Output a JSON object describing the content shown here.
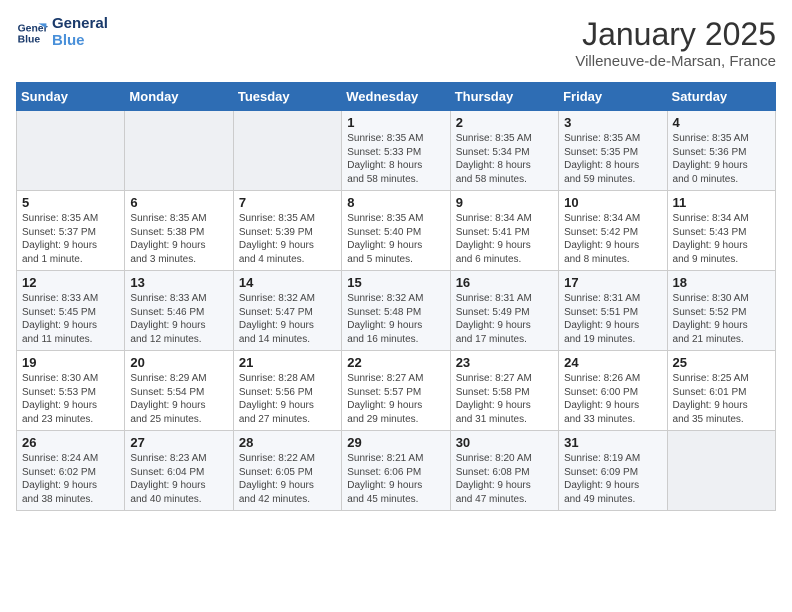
{
  "logo": {
    "line1": "General",
    "line2": "Blue"
  },
  "title": "January 2025",
  "subtitle": "Villeneuve-de-Marsan, France",
  "days_of_week": [
    "Sunday",
    "Monday",
    "Tuesday",
    "Wednesday",
    "Thursday",
    "Friday",
    "Saturday"
  ],
  "weeks": [
    [
      {
        "day": "",
        "info": ""
      },
      {
        "day": "",
        "info": ""
      },
      {
        "day": "",
        "info": ""
      },
      {
        "day": "1",
        "info": "Sunrise: 8:35 AM\nSunset: 5:33 PM\nDaylight: 8 hours\nand 58 minutes."
      },
      {
        "day": "2",
        "info": "Sunrise: 8:35 AM\nSunset: 5:34 PM\nDaylight: 8 hours\nand 58 minutes."
      },
      {
        "day": "3",
        "info": "Sunrise: 8:35 AM\nSunset: 5:35 PM\nDaylight: 8 hours\nand 59 minutes."
      },
      {
        "day": "4",
        "info": "Sunrise: 8:35 AM\nSunset: 5:36 PM\nDaylight: 9 hours\nand 0 minutes."
      }
    ],
    [
      {
        "day": "5",
        "info": "Sunrise: 8:35 AM\nSunset: 5:37 PM\nDaylight: 9 hours\nand 1 minute."
      },
      {
        "day": "6",
        "info": "Sunrise: 8:35 AM\nSunset: 5:38 PM\nDaylight: 9 hours\nand 3 minutes."
      },
      {
        "day": "7",
        "info": "Sunrise: 8:35 AM\nSunset: 5:39 PM\nDaylight: 9 hours\nand 4 minutes."
      },
      {
        "day": "8",
        "info": "Sunrise: 8:35 AM\nSunset: 5:40 PM\nDaylight: 9 hours\nand 5 minutes."
      },
      {
        "day": "9",
        "info": "Sunrise: 8:34 AM\nSunset: 5:41 PM\nDaylight: 9 hours\nand 6 minutes."
      },
      {
        "day": "10",
        "info": "Sunrise: 8:34 AM\nSunset: 5:42 PM\nDaylight: 9 hours\nand 8 minutes."
      },
      {
        "day": "11",
        "info": "Sunrise: 8:34 AM\nSunset: 5:43 PM\nDaylight: 9 hours\nand 9 minutes."
      }
    ],
    [
      {
        "day": "12",
        "info": "Sunrise: 8:33 AM\nSunset: 5:45 PM\nDaylight: 9 hours\nand 11 minutes."
      },
      {
        "day": "13",
        "info": "Sunrise: 8:33 AM\nSunset: 5:46 PM\nDaylight: 9 hours\nand 12 minutes."
      },
      {
        "day": "14",
        "info": "Sunrise: 8:32 AM\nSunset: 5:47 PM\nDaylight: 9 hours\nand 14 minutes."
      },
      {
        "day": "15",
        "info": "Sunrise: 8:32 AM\nSunset: 5:48 PM\nDaylight: 9 hours\nand 16 minutes."
      },
      {
        "day": "16",
        "info": "Sunrise: 8:31 AM\nSunset: 5:49 PM\nDaylight: 9 hours\nand 17 minutes."
      },
      {
        "day": "17",
        "info": "Sunrise: 8:31 AM\nSunset: 5:51 PM\nDaylight: 9 hours\nand 19 minutes."
      },
      {
        "day": "18",
        "info": "Sunrise: 8:30 AM\nSunset: 5:52 PM\nDaylight: 9 hours\nand 21 minutes."
      }
    ],
    [
      {
        "day": "19",
        "info": "Sunrise: 8:30 AM\nSunset: 5:53 PM\nDaylight: 9 hours\nand 23 minutes."
      },
      {
        "day": "20",
        "info": "Sunrise: 8:29 AM\nSunset: 5:54 PM\nDaylight: 9 hours\nand 25 minutes."
      },
      {
        "day": "21",
        "info": "Sunrise: 8:28 AM\nSunset: 5:56 PM\nDaylight: 9 hours\nand 27 minutes."
      },
      {
        "day": "22",
        "info": "Sunrise: 8:27 AM\nSunset: 5:57 PM\nDaylight: 9 hours\nand 29 minutes."
      },
      {
        "day": "23",
        "info": "Sunrise: 8:27 AM\nSunset: 5:58 PM\nDaylight: 9 hours\nand 31 minutes."
      },
      {
        "day": "24",
        "info": "Sunrise: 8:26 AM\nSunset: 6:00 PM\nDaylight: 9 hours\nand 33 minutes."
      },
      {
        "day": "25",
        "info": "Sunrise: 8:25 AM\nSunset: 6:01 PM\nDaylight: 9 hours\nand 35 minutes."
      }
    ],
    [
      {
        "day": "26",
        "info": "Sunrise: 8:24 AM\nSunset: 6:02 PM\nDaylight: 9 hours\nand 38 minutes."
      },
      {
        "day": "27",
        "info": "Sunrise: 8:23 AM\nSunset: 6:04 PM\nDaylight: 9 hours\nand 40 minutes."
      },
      {
        "day": "28",
        "info": "Sunrise: 8:22 AM\nSunset: 6:05 PM\nDaylight: 9 hours\nand 42 minutes."
      },
      {
        "day": "29",
        "info": "Sunrise: 8:21 AM\nSunset: 6:06 PM\nDaylight: 9 hours\nand 45 minutes."
      },
      {
        "day": "30",
        "info": "Sunrise: 8:20 AM\nSunset: 6:08 PM\nDaylight: 9 hours\nand 47 minutes."
      },
      {
        "day": "31",
        "info": "Sunrise: 8:19 AM\nSunset: 6:09 PM\nDaylight: 9 hours\nand 49 minutes."
      },
      {
        "day": "",
        "info": ""
      }
    ]
  ]
}
